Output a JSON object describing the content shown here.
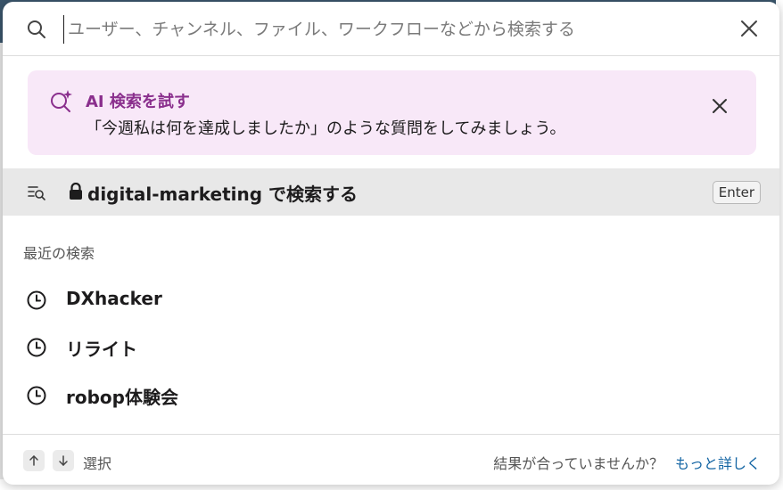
{
  "search": {
    "placeholder": "ユーザー、チャンネル、ファイル、ワークフローなどから検索する",
    "value": ""
  },
  "ai_banner": {
    "title": "AI 検索を試す",
    "description": "「今週私は何を達成しましたか」のような質問をしてみましょう。",
    "accent_color": "#8a2f8d",
    "background_color": "#f8e8f8"
  },
  "channel_search": {
    "channel": "digital-marketing",
    "suffix": " で検索する",
    "key_hint": "Enter"
  },
  "recent": {
    "heading": "最近の検索",
    "items": [
      {
        "label": "DXhacker"
      },
      {
        "label": "リライト"
      },
      {
        "label": "robop体験会"
      }
    ]
  },
  "footer": {
    "select_label": "選択",
    "feedback_text": "結果が合っていませんか？",
    "feedback_link": "もっと詳しく",
    "link_color": "#1264a3"
  }
}
